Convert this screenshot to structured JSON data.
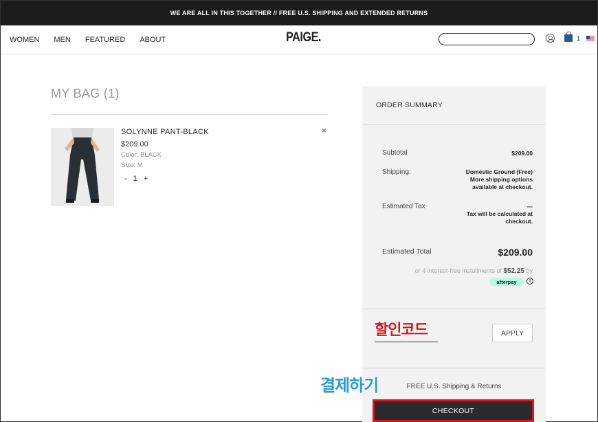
{
  "promo_bar": {
    "text": "WE ARE ALL IN THIS TOGETHER  //  FREE U.S. SHIPPING AND EXTENDED RETURNS"
  },
  "header": {
    "nav": [
      "WOMEN",
      "MEN",
      "FEATURED",
      "ABOUT"
    ],
    "logo": "PAIGE.",
    "search": {
      "value": "",
      "placeholder": ""
    },
    "bag_count": "1",
    "icons": [
      "user-icon",
      "shopping-bag-icon",
      "us-flag-icon"
    ]
  },
  "bag": {
    "title": "MY BAG (1)",
    "item": {
      "name": "SOLYNNE PANT-BLACK",
      "price": "$209.00",
      "color": "Color: BLACK",
      "size": "Size: M",
      "qty_minus": "-",
      "qty": "1",
      "qty_plus": "+",
      "remove": "×"
    }
  },
  "summary": {
    "title": "ORDER SUMMARY",
    "subtotal_label": "Subtotal",
    "subtotal_value": "$209.00",
    "shipping_label": "Shipping:",
    "shipping_value": "Domestic Ground (Free)",
    "shipping_note_1": "More shipping options",
    "shipping_note_2": "available at checkout.",
    "tax_label": "Estimated Tax",
    "tax_value": "---",
    "tax_note_1": "Tax will be calculated at",
    "tax_note_2": "checkout.",
    "total_label": "Estimated Total",
    "total_value": "$209.00",
    "afterpay_prefix": "or 4 interest-free installments of",
    "afterpay_amount": "$52.25",
    "afterpay_suffix": "by",
    "afterpay_badge": "afterpay",
    "info_icon": "i",
    "promo_code_label": "할인코드",
    "apply_label": "APPLY",
    "shipping_returns": "FREE U.S. Shipping & Returns",
    "checkout_label": "CHECKOUT"
  },
  "annotation": {
    "pay_label": "결제하기"
  },
  "colors": {
    "accent_red": "#e0141a",
    "annotation_blue": "#2c9ad6",
    "checkout_bg": "#2b2b2b",
    "afterpay_mint": "#b2fce4"
  }
}
